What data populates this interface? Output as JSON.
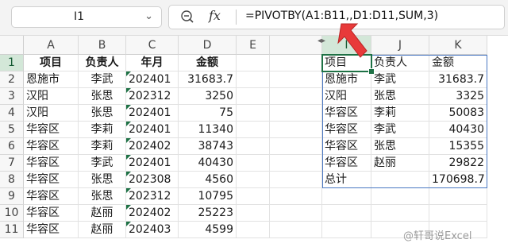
{
  "name_box": {
    "value": "I1"
  },
  "formula_bar": {
    "fx_label": "fx",
    "formula": "=PIVOTBY(A1:B11,,D1:D11,SUM,3)"
  },
  "columns": [
    "A",
    "B",
    "C",
    "D",
    "E",
    "",
    "I",
    "J",
    "K"
  ],
  "rows": [
    "1",
    "2",
    "3",
    "4",
    "5",
    "6",
    "7",
    "8",
    "9",
    "10",
    "11"
  ],
  "source_table": {
    "headers": [
      "项目",
      "负责人",
      "年月",
      "金额"
    ],
    "rows": [
      [
        "恩施市",
        "李武",
        "202401",
        "31683.7"
      ],
      [
        "汉阳",
        "张思",
        "202312",
        "3250"
      ],
      [
        "汉阳",
        "张思",
        "202401",
        "75"
      ],
      [
        "华容区",
        "李莉",
        "202401",
        "11340"
      ],
      [
        "华容区",
        "李莉",
        "202402",
        "38743"
      ],
      [
        "华容区",
        "李武",
        "202401",
        "40430"
      ],
      [
        "华容区",
        "张思",
        "202308",
        "4560"
      ],
      [
        "华容区",
        "张思",
        "202312",
        "10795"
      ],
      [
        "华容区",
        "赵丽",
        "202402",
        "25223"
      ],
      [
        "华容区",
        "赵丽",
        "202403",
        "4599"
      ]
    ]
  },
  "pivot_table": {
    "headers": [
      "项目",
      "负责人",
      "金额"
    ],
    "rows": [
      [
        "恩施市",
        "李武",
        "31683.7"
      ],
      [
        "汉阳",
        "张思",
        "3325"
      ],
      [
        "华容区",
        "李莉",
        "50083"
      ],
      [
        "华容区",
        "李武",
        "40430"
      ],
      [
        "华容区",
        "张思",
        "15355"
      ],
      [
        "华容区",
        "赵丽",
        "29822"
      ],
      [
        "总计",
        "",
        "170698.7"
      ]
    ]
  },
  "watermark": "@轩哥说Excel",
  "colors": {
    "accent": "#1e7145",
    "pivot_border": "#4a78c2",
    "arrow": "#e83a3a"
  }
}
